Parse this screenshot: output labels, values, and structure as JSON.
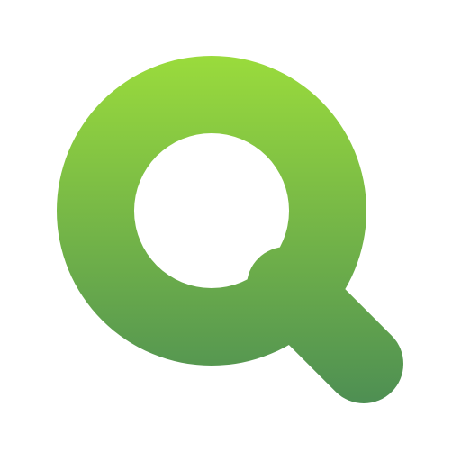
{
  "icon": {
    "name": "search-icon",
    "gradient_top": "#9ADB3C",
    "gradient_bottom": "#4E8F53",
    "background": "#FFFFFF"
  }
}
